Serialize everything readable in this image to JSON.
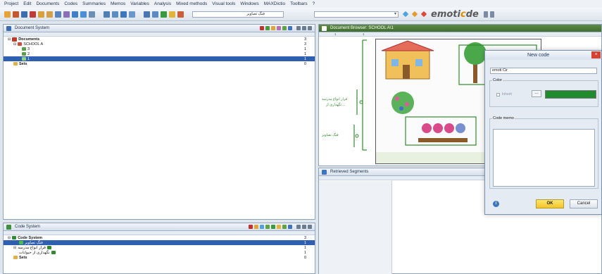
{
  "menu": [
    "Project",
    "Edit",
    "Documents",
    "Codes",
    "Summaries",
    "Memos",
    "Variables",
    "Analysis",
    "Mixed methods",
    "Visual tools",
    "Windows",
    "MAXDictio",
    "Toolbars",
    "?"
  ],
  "toolbar": {
    "code_select": "فنگ تصاویر",
    "logo_text": "emoti",
    "logo_accent": "c",
    "logo_rest": "de"
  },
  "document_system": {
    "title": "Document System",
    "root": {
      "label": "Documents",
      "count": "3"
    },
    "group": {
      "label": "SCHOOL A",
      "count": "3"
    },
    "docs": [
      {
        "label": "3",
        "count": "1"
      },
      {
        "label": "2",
        "count": "1"
      },
      {
        "label": "1",
        "count": "1"
      }
    ],
    "sets": {
      "label": "Sets",
      "count": "0"
    }
  },
  "code_system": {
    "title": "Code System",
    "root": {
      "label": "Code System",
      "count": "3"
    },
    "codes": [
      {
        "label": "فنگ تصاویر",
        "count": "1",
        "selected": true
      },
      {
        "label": "قرار انواع مدرسه",
        "count": "1",
        "selected": false
      },
      {
        "label": "نگهداری از حیوانات",
        "count": "1",
        "selected": false
      }
    ],
    "sets": {
      "label": "Sets",
      "count": "0"
    }
  },
  "document_browser": {
    "title": "Document Browser: SCHOOL A\\1",
    "ruler_marks": [
      "1",
      "1"
    ],
    "code_labels": [
      "قرار انواع مدرسه",
      "نگهداری از ...",
      "فنگ تصاویر"
    ]
  },
  "retrieved_segments": {
    "title": "Retrieved Segments"
  },
  "dialog": {
    "title": "New code",
    "name_value": "emoti Cir",
    "color_label": "Color",
    "inherit_label": "Inherit",
    "swatch_color": "#1f8a2e",
    "memo_label": "Code memo",
    "ok_label": "OK",
    "cancel_label": "Cancel"
  },
  "colors": {
    "selection": "#2f5fb0",
    "code_green": "#2e8b2e",
    "doc_red": "#c0392b"
  }
}
